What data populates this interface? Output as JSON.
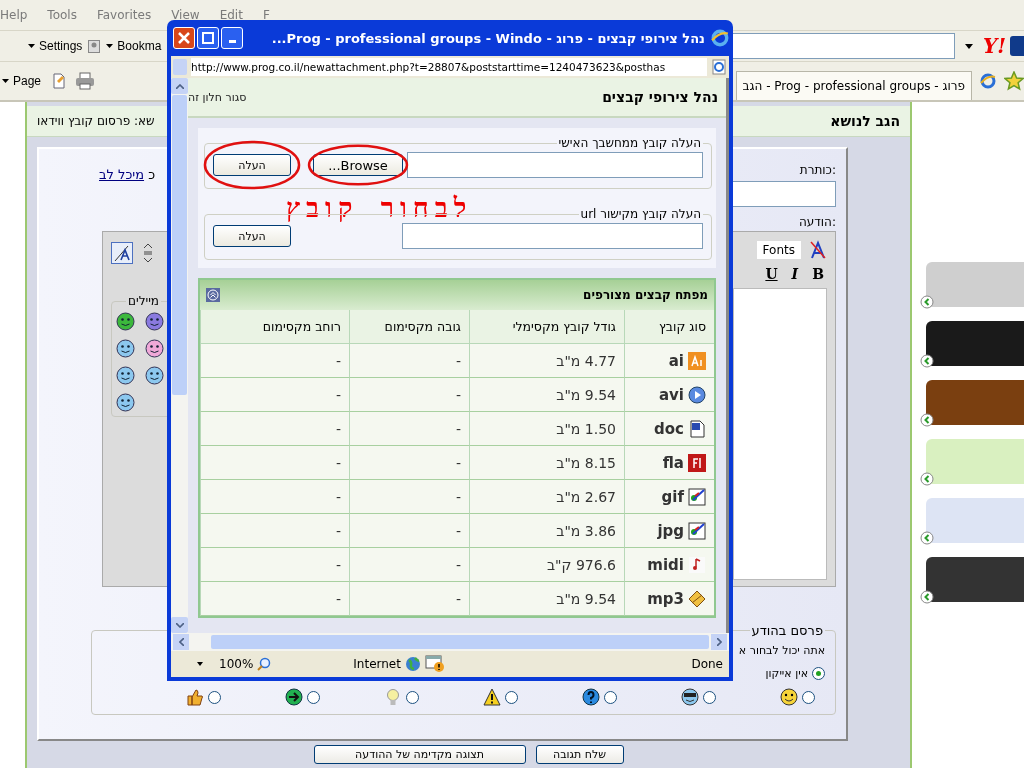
{
  "browser": {
    "menu": [
      "F",
      "Edit",
      "View",
      "Favorites",
      "Tools",
      "Help"
    ],
    "settings": "Settings",
    "bookmarks": "Bookma",
    "logo": "Y!",
    "page": "Page",
    "tab": "פרוג - Prog - professional groups - הגב"
  },
  "page": {
    "title": "הגב לנושא",
    "topic": "שא: פרסום קובץ ווידאו",
    "subject_label": "כותרת:",
    "author_prefix": "כ",
    "author_link": "מיכל לב",
    "message_label": "הודעה:",
    "fonts": "Fonts",
    "format_buttons": [
      {
        "kind": "bold",
        "label": "B"
      },
      {
        "kind": "italic",
        "label": "I"
      },
      {
        "kind": "underline",
        "label": "U"
      }
    ],
    "smilies_legend": "מיילים",
    "post_icon_legend": "פרסם בהודע",
    "post_icon_hint": "אתה יכול לבחור א",
    "post_icons": [
      {
        "kind": "none",
        "label": "אין אייקון",
        "selected": true
      },
      {
        "kind": "smile",
        "selected": false
      },
      {
        "kind": "cool",
        "selected": false
      },
      {
        "kind": "question",
        "selected": false
      },
      {
        "kind": "warning",
        "selected": false
      },
      {
        "kind": "bulb",
        "selected": false
      },
      {
        "kind": "arrow",
        "selected": false
      },
      {
        "kind": "thumb",
        "selected": false
      }
    ],
    "buttons": [
      "שלח תגובה",
      "תצוגה מקדימה של ההודעה"
    ]
  },
  "popup": {
    "title": "נהל צירופי קבצים - פרוג - Prog - professional groups - Windo...",
    "address": "http://www.prog.co.il/newattachment.php?t=28807&poststarttime=1240473623&posthas",
    "heading": "נהל צירופי קבצים",
    "close_link": "סגור חלון זה",
    "local_legend": "העלה קובץ ממחשבך האישי",
    "browse": "Browse...",
    "upload": "העלה",
    "annotation": "לבחור קובץ",
    "url_legend": "העלה קובץ מקישור url",
    "url_upload": "העלה",
    "table_title": "מפתח קבצים מצורפים",
    "columns": [
      "סוג קובץ",
      "גודל קובץ מקסימלי",
      "גובה מקסימום",
      "רוחב מקסימום"
    ],
    "rows": [
      {
        "type": "ai",
        "kind": "ai",
        "size": "4.77 מ\"ב",
        "height": "-",
        "width": "-"
      },
      {
        "type": "avi",
        "kind": "avi",
        "size": "9.54 מ\"ב",
        "height": "-",
        "width": "-"
      },
      {
        "type": "doc",
        "kind": "doc",
        "size": "1.50 מ\"ב",
        "height": "-",
        "width": "-"
      },
      {
        "type": "fla",
        "kind": "fla",
        "size": "8.15 מ\"ב",
        "height": "-",
        "width": "-"
      },
      {
        "type": "gif",
        "kind": "image",
        "size": "2.67 מ\"ב",
        "height": "-",
        "width": "-"
      },
      {
        "type": "jpg",
        "kind": "image",
        "size": "3.86 מ\"ב",
        "height": "-",
        "width": "-"
      },
      {
        "type": "midi",
        "kind": "midi",
        "size": "976.6 ק\"ב",
        "height": "-",
        "width": "-"
      },
      {
        "type": "mp3",
        "kind": "mp3",
        "size": "9.54 מ\"ב",
        "height": "-",
        "width": "-"
      }
    ],
    "zoom": "100%",
    "zone": "Internet",
    "state": "Done"
  }
}
